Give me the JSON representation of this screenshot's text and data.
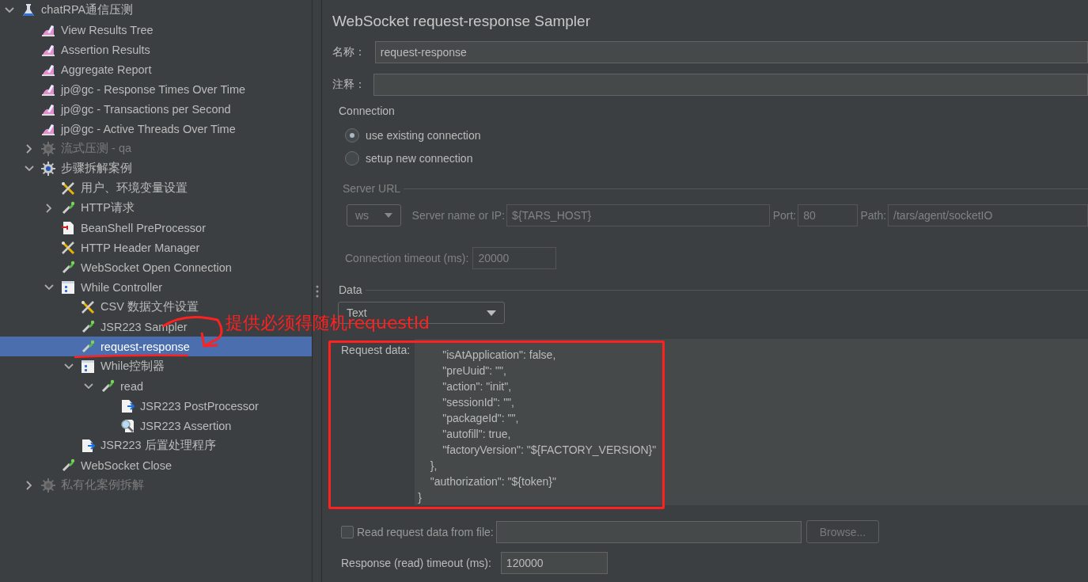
{
  "tree": [
    {
      "label": "chatRPA通信压测",
      "kind": "testplan",
      "expanded": true,
      "selected": false,
      "disabled": false,
      "children": [
        {
          "label": "View Results Tree",
          "kind": "listener",
          "selected": false,
          "disabled": false
        },
        {
          "label": "Assertion Results",
          "kind": "listener",
          "selected": false,
          "disabled": false
        },
        {
          "label": "Aggregate Report",
          "kind": "listener",
          "selected": false,
          "disabled": false
        },
        {
          "label": "jp@gc - Response Times Over Time",
          "kind": "listener",
          "selected": false,
          "disabled": false
        },
        {
          "label": "jp@gc - Transactions per Second",
          "kind": "listener",
          "selected": false,
          "disabled": false
        },
        {
          "label": "jp@gc - Active Threads Over Time",
          "kind": "listener",
          "selected": false,
          "disabled": false
        },
        {
          "label": "流式压测 - qa",
          "kind": "threadgroup",
          "expanded": false,
          "selected": false,
          "disabled": true
        },
        {
          "label": "步骤拆解案例",
          "kind": "threadgroup",
          "expanded": true,
          "selected": false,
          "disabled": false,
          "children": [
            {
              "label": "用户、环境变量设置",
              "kind": "config",
              "selected": false,
              "disabled": false
            },
            {
              "label": "HTTP请求",
              "kind": "sampler",
              "expanded": false,
              "selected": false,
              "disabled": false
            },
            {
              "label": "BeanShell PreProcessor",
              "kind": "preprocessor",
              "selected": false,
              "disabled": false
            },
            {
              "label": "HTTP Header Manager",
              "kind": "config",
              "selected": false,
              "disabled": false
            },
            {
              "label": "WebSocket Open Connection",
              "kind": "sampler",
              "selected": false,
              "disabled": false
            },
            {
              "label": "While Controller",
              "kind": "controller",
              "expanded": true,
              "selected": false,
              "disabled": false,
              "children": [
                {
                  "label": "CSV 数据文件设置",
                  "kind": "config",
                  "selected": false,
                  "disabled": false
                },
                {
                  "label": "JSR223 Sampler",
                  "kind": "sampler",
                  "selected": false,
                  "disabled": false
                },
                {
                  "label": "request-response",
                  "kind": "sampler",
                  "selected": true,
                  "disabled": false
                },
                {
                  "label": "While控制器",
                  "kind": "controller",
                  "expanded": true,
                  "selected": false,
                  "disabled": false,
                  "children": [
                    {
                      "label": "read",
                      "kind": "sampler",
                      "expanded": true,
                      "selected": false,
                      "disabled": false,
                      "children": [
                        {
                          "label": "JSR223 PostProcessor",
                          "kind": "postprocessor",
                          "selected": false,
                          "disabled": false
                        },
                        {
                          "label": "JSR223 Assertion",
                          "kind": "assertion",
                          "selected": false,
                          "disabled": false
                        }
                      ]
                    }
                  ]
                },
                {
                  "label": "JSR223 后置处理程序",
                  "kind": "postprocessor",
                  "selected": false,
                  "disabled": false
                }
              ]
            },
            {
              "label": "WebSocket Close",
              "kind": "sampler",
              "selected": false,
              "disabled": false
            }
          ]
        },
        {
          "label": "私有化案例拆解",
          "kind": "threadgroup",
          "expanded": false,
          "selected": false,
          "disabled": true
        }
      ]
    }
  ],
  "sampler": {
    "title": "WebSocket request-response Sampler",
    "name_label": "名称：",
    "name_value": "request-response",
    "comment_label": "注释：",
    "connection": {
      "legend": "Connection",
      "options": [
        {
          "label": "use existing connection",
          "selected": true
        },
        {
          "label": "setup new connection",
          "selected": false
        }
      ]
    },
    "server_url": {
      "legend": "Server URL",
      "disabled": true,
      "protocol": "ws",
      "server_label": "Server name or IP:",
      "server_value": "${TARS_HOST}",
      "port_label": "Port:",
      "port_value": "80",
      "path_label": "Path:",
      "path_value": "/tars/agent/socketIO",
      "timeout_label": "Connection timeout (ms):",
      "timeout_value": "20000"
    },
    "data": {
      "legend": "Data",
      "type": "Text",
      "request_label": "Request data:",
      "request_lines": [
        "        \"isAtApplication\": false,",
        "        \"preUuid\": \"\",",
        "        \"action\": \"init\",",
        "        \"sessionId\": \"\",",
        "        \"packageId\": \"\",",
        "        \"autofill\": true,",
        "        \"factoryVersion\": \"${FACTORY_VERSION}\"",
        "    },",
        "    \"authorization\": \"${token}\"",
        "}"
      ],
      "file_checkbox": {
        "label": "Read request data from file:",
        "checked": false
      },
      "browse_button": {
        "label": "Browse...",
        "disabled": true
      },
      "response_timeout_label": "Response (read) timeout (ms):",
      "response_timeout_value": "120000"
    }
  },
  "annotation": {
    "text": "提供必须得随机requestId"
  }
}
